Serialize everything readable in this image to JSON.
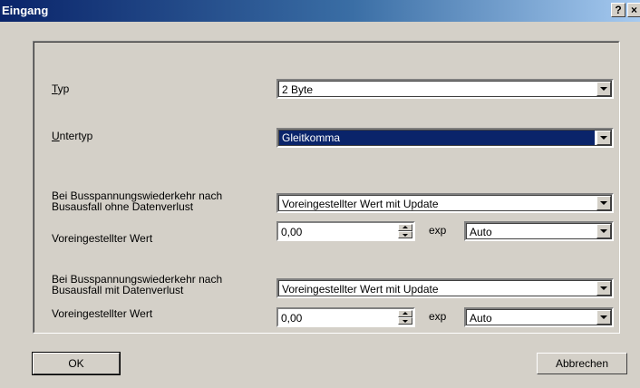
{
  "window": {
    "title": "Eingang",
    "help_glyph": "?",
    "close_glyph": "×"
  },
  "form": {
    "typ": {
      "label": "Typ",
      "value": "2 Byte"
    },
    "untertyp": {
      "label": "Untertyp",
      "value": "Gleitkomma"
    },
    "section1": {
      "label_line1": "Bei Busspannungswiederkehr nach",
      "label_line2": "Busausfall ohne Datenverlust",
      "mode_value": "Voreingestellter Wert mit Update",
      "default_label": "Voreingestellter Wert",
      "default_value": "0,00",
      "exp_label": "exp",
      "exp_value": "Auto"
    },
    "section2": {
      "label_line1": "Bei Busspannungswiederkehr nach",
      "label_line2": "Busausfall mit Datenverlust",
      "mode_value": "Voreingestellter Wert mit Update",
      "default_label": "Voreingestellter Wert",
      "default_value": "0,00",
      "exp_label": "exp",
      "exp_value": "Auto"
    }
  },
  "buttons": {
    "ok": "OK",
    "cancel": "Abbrechen"
  },
  "colors": {
    "dialog_bg": "#d4d0c8",
    "titlebar": "#0a246a",
    "selection": "#0a246a"
  }
}
